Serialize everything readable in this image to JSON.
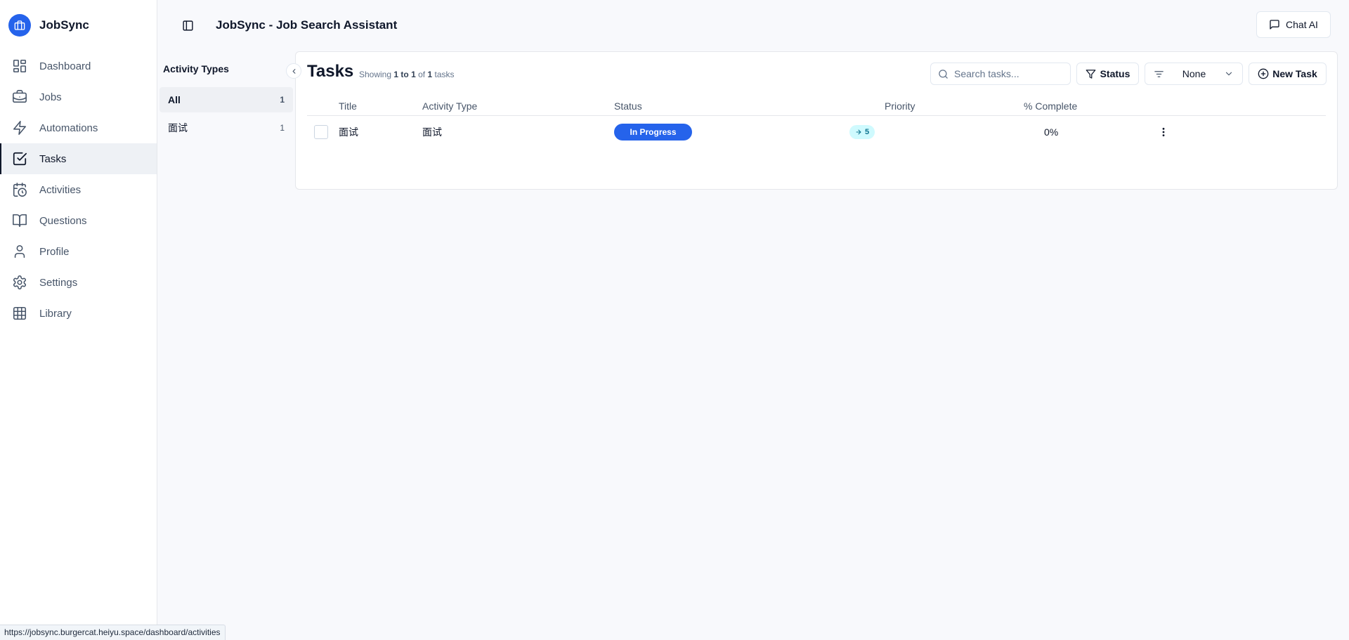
{
  "app": {
    "name": "JobSync",
    "header_title": "JobSync - Job Search Assistant",
    "chat_button": "Chat AI"
  },
  "sidebar": {
    "items": [
      {
        "label": "Dashboard",
        "icon": "dashboard-icon"
      },
      {
        "label": "Jobs",
        "icon": "briefcase-icon"
      },
      {
        "label": "Automations",
        "icon": "zap-icon"
      },
      {
        "label": "Tasks",
        "icon": "check-square-icon",
        "active": true
      },
      {
        "label": "Activities",
        "icon": "calendar-clock-icon"
      },
      {
        "label": "Questions",
        "icon": "book-icon"
      },
      {
        "label": "Profile",
        "icon": "user-icon"
      },
      {
        "label": "Settings",
        "icon": "gear-icon"
      },
      {
        "label": "Library",
        "icon": "table-icon"
      }
    ]
  },
  "activity_types": {
    "title": "Activity Types",
    "items": [
      {
        "label": "All",
        "count": "1",
        "active": true
      },
      {
        "label": "面试",
        "count": "1"
      }
    ]
  },
  "tasks": {
    "title": "Tasks",
    "showing_prefix": "Showing",
    "range_start": "1",
    "range_to": "to",
    "range_end": "1",
    "of_word": "of",
    "total": "1",
    "tasks_word": "tasks",
    "search_placeholder": "Search tasks...",
    "status_filter_label": "Status",
    "sort_value": "None",
    "new_task_label": "New Task",
    "columns": {
      "title": "Title",
      "activity_type": "Activity Type",
      "status": "Status",
      "priority": "Priority",
      "complete": "% Complete"
    },
    "rows": [
      {
        "title": "面试",
        "activity_type": "面试",
        "status": "In Progress",
        "priority": "5",
        "complete": "0%"
      }
    ]
  },
  "status_bar_url": "https://jobsync.burgercat.heiyu.space/dashboard/activities",
  "colors": {
    "accent": "#2563eb",
    "priority_bg": "#cffafe",
    "priority_text": "#0e7490"
  }
}
